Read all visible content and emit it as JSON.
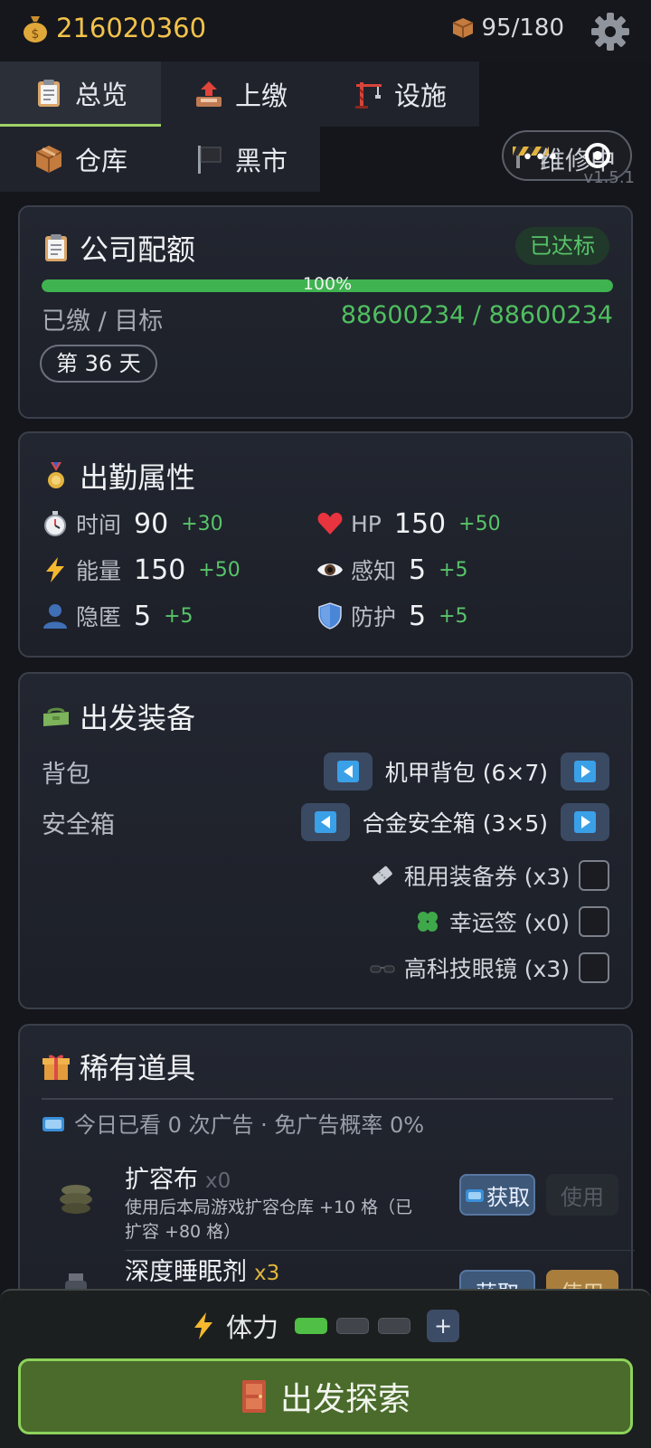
{
  "header": {
    "money": "216020360",
    "capacity": "95/180",
    "version": "v1.5.1"
  },
  "tabs": [
    {
      "label": "总览",
      "icon": "clipboard-icon",
      "active": true
    },
    {
      "label": "上缴",
      "icon": "upload-tray-icon",
      "active": false
    },
    {
      "label": "设施",
      "icon": "crane-icon",
      "active": false
    },
    {
      "label": "维修中",
      "icon": "barrier-icon",
      "active": false
    },
    {
      "label": "仓库",
      "icon": "box-icon",
      "active": false
    },
    {
      "label": "黑市",
      "icon": "black-flag-icon",
      "active": false
    }
  ],
  "quota": {
    "title": "公司配额",
    "badge": "已达标",
    "progress": 1.0,
    "progress_label": "100%",
    "paid_label": "已缴 / 目标",
    "paid_value": "88600234 / 88600234",
    "day": "第 36 天"
  },
  "attributes": {
    "title": "出勤属性",
    "items": [
      {
        "name": "时间",
        "value": "90",
        "bonus": "+30",
        "icon": "stopwatch-icon"
      },
      {
        "name": "HP",
        "value": "150",
        "bonus": "+50",
        "icon": "heart-icon"
      },
      {
        "name": "能量",
        "value": "150",
        "bonus": "+50",
        "icon": "lightning-icon"
      },
      {
        "name": "感知",
        "value": "5",
        "bonus": "+5",
        "icon": "eye-icon"
      },
      {
        "name": "隐匿",
        "value": "5",
        "bonus": "+5",
        "icon": "person-silhouette-icon"
      },
      {
        "name": "防护",
        "value": "5",
        "bonus": "+5",
        "icon": "shield-icon"
      }
    ]
  },
  "equipment": {
    "title": "出发装备",
    "backpack_label": "背包",
    "backpack_value": "机甲背包 (6×7)",
    "safe_label": "安全箱",
    "safe_value": "合金安全箱 (3×5)",
    "options": [
      {
        "label": "租用装备券 (x3)",
        "icon": "ticket-icon",
        "checked": false
      },
      {
        "label": "幸运签 (x0)",
        "icon": "clover-icon",
        "checked": false
      },
      {
        "label": "高科技眼镜 (x3)",
        "icon": "glasses-icon",
        "checked": false
      }
    ]
  },
  "rare": {
    "title": "稀有道具",
    "ad_note": "今日已看 0 次广告 · 免广告概率 0%",
    "items": [
      {
        "name": "扩容布",
        "qty": "x0",
        "desc": "使用后本局游戏扩容仓库 +10 格（已扩容 +80 格）",
        "get": "获取",
        "use": "使用"
      },
      {
        "name": "深度睡眠剂",
        "qty": "x3",
        "desc": "",
        "get": "获取",
        "use": "使用"
      }
    ]
  },
  "bottom": {
    "stamina_label": "体力",
    "stamina_filled": 1,
    "stamina_total": 3,
    "plus": "+",
    "go_label": "出发探索"
  }
}
